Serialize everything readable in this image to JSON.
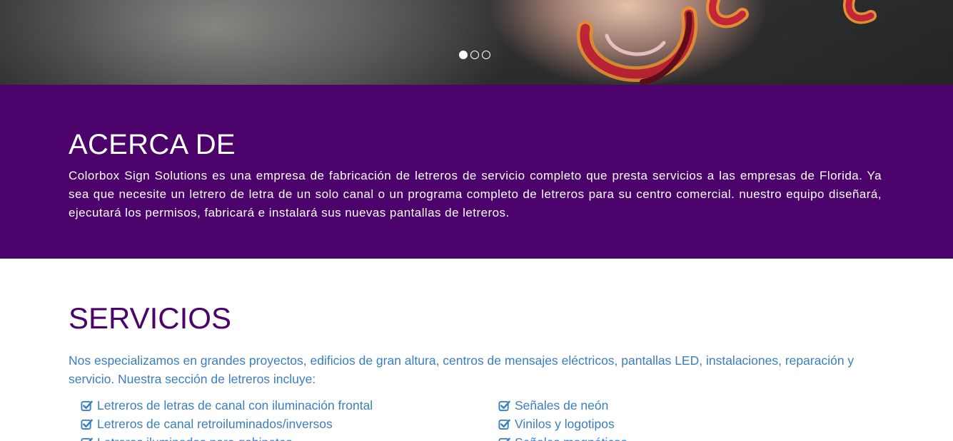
{
  "hero": {
    "slides": 3,
    "active_slide": 1,
    "dots": [
      "slide-1",
      "slide-2",
      "slide-3"
    ]
  },
  "about": {
    "title": "ACERCA DE",
    "text": "Colorbox Sign Solutions es una empresa de fabricación de letreros de servicio completo que presta servicios a las empresas de Florida. Ya sea que necesite un letrero de letra de un solo canal o un programa completo de letreros para su centro comercial. nuestro equipo diseñará, ejecutará los permisos, fabricará e instalará sus nuevas pantallas de letreros."
  },
  "services": {
    "title": "SERVICIOS",
    "intro": "Nos especializamos en grandes proyectos, edificios de gran altura, centros de mensajes eléctricos, pantallas LED, instalaciones, reparación y servicio. Nuestra sección de letreros incluye:",
    "column1": [
      "Letreros de letras de canal con iluminación frontal",
      "Letreros de canal retroiluminados/inversos",
      "Letreros iluminados para gabinetes"
    ],
    "column2": [
      "Señales de neón",
      "Vinilos y logotipos",
      "Señales magnéticas"
    ]
  },
  "colors": {
    "brand_purple": "#4b026b",
    "link_blue": "#3a7ec0",
    "white": "#ffffff"
  },
  "icons": {
    "list_bullet": "check-square-icon"
  }
}
